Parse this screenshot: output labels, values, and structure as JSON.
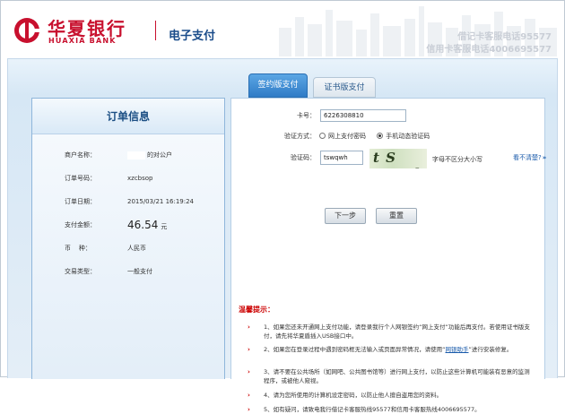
{
  "header": {
    "brand_cn": "华夏银行",
    "brand_en": "HUAXIA BANK",
    "section_title": "电子支付",
    "hotline_debit": "借记卡客服电话95577",
    "hotline_credit": "信用卡客服电话4006695577"
  },
  "colors": {
    "brand_red": "#c8102e",
    "link_blue": "#1a5bab",
    "tab_active_blue": "#3a86d0"
  },
  "tabs": [
    {
      "label": "签约版支付",
      "active": true
    },
    {
      "label": "证书版支付",
      "active": false
    }
  ],
  "order": {
    "title": "订单信息",
    "fields": [
      {
        "label": "商户名称：",
        "value": "的对公户"
      },
      {
        "label": "订单号码：",
        "value": "xzcbsop"
      },
      {
        "label": "订单日期：",
        "value": "2015/03/21 16:19:24"
      },
      {
        "label": "支付金额：",
        "value": "46.54",
        "unit": "元"
      },
      {
        "label": "币    种：",
        "value": "人民币"
      },
      {
        "label": "交易类型：",
        "value": "一般支付"
      }
    ]
  },
  "payment": {
    "card_label": "卡号：",
    "card_value": "6226308810",
    "verify_label": "验证方式：",
    "verify_options": [
      {
        "label": "网上支付密码",
        "selected": false
      },
      {
        "label": "手机动态验证码",
        "selected": true
      }
    ],
    "captcha_label": "验证码：",
    "captcha_value": "tswqwh",
    "captcha_image_text": "t S wQWh",
    "captcha_hint": "字母不区分大小写",
    "refresh_link": "看不清楚?",
    "next_button": "下一步",
    "reset_button": "重置"
  },
  "tips": {
    "title": "温馨提示：",
    "items": [
      {
        "text": "1、如果您还未开通网上支付功能，请登录我行个人网银签约“网上支付”功能后再支付。若使用证书版支付，请先将华夏盾插入USB接口中。"
      },
      {
        "text_before": "2、如果您在登录过程中遇到密码框无法输入或页面异常情况，请使用“",
        "link": "网银助手",
        "text_after": "”进行安装修复。"
      },
      {
        "text": "3、请不要在公共场所（如网吧、公共图书馆等）进行网上支付，以防止这些计算机可能装有恶意的监测程序，或被他人窥视。"
      },
      {
        "text": "4、请为您所使用的计算机设定密码，以防止他人擅自盗用您的资料。"
      },
      {
        "text": "5、如有疑问，请致电我行借记卡客服热线95577和信用卡客服热线4006695577。"
      }
    ]
  }
}
